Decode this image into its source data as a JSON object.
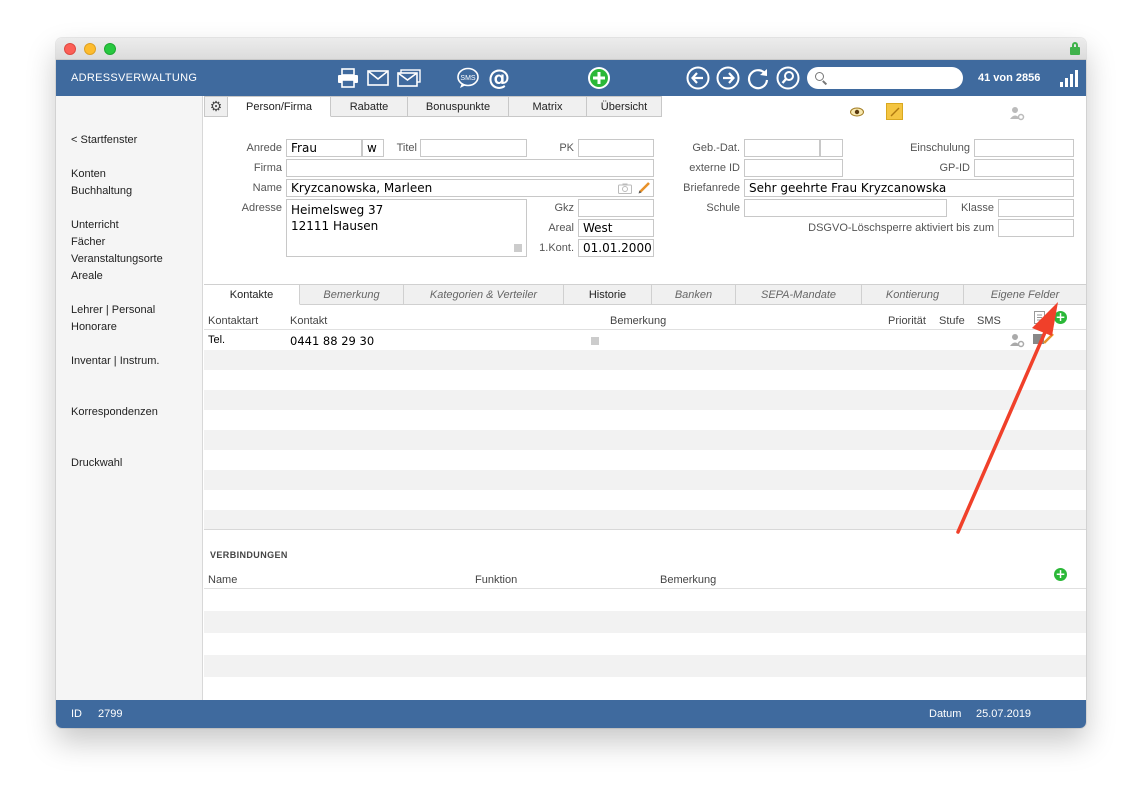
{
  "app": {
    "title": "ADRESSVERWALTUNG",
    "record_count": "41 von 2856",
    "search_placeholder": ""
  },
  "toolbar_icons": [
    "printer-icon",
    "envelope-icon",
    "envelopes-icon",
    "sms-icon",
    "at-icon",
    "add-record-icon",
    "back-arrow-icon",
    "forward-arrow-icon",
    "refresh-icon",
    "search-magnifier-icon"
  ],
  "sidebar": {
    "items": [
      "< Startfenster",
      "Konten",
      "Buchhaltung",
      "Unterricht",
      "Fächer",
      "Veranstaltungsorte",
      "Areale",
      "Lehrer | Personal",
      "Honorare",
      "Inventar | Instrum.",
      "Korrespondenzen",
      "Druckwahl"
    ]
  },
  "top_tabs": [
    "Person/Firma",
    "Rabatte",
    "Bonuspunkte",
    "Matrix",
    "Übersicht"
  ],
  "form": {
    "labels": {
      "anrede": "Anrede",
      "titel": "Titel",
      "pk": "PK",
      "firma": "Firma",
      "name": "Name",
      "adresse": "Adresse",
      "gkz": "Gkz",
      "areal": "Areal",
      "erstkontakt": "1.Kont.",
      "geb_dat": "Geb.-Dat.",
      "einschulung": "Einschulung",
      "externe_id": "externe ID",
      "gp_id": "GP-ID",
      "briefanrede": "Briefanrede",
      "schule": "Schule",
      "klasse": "Klasse",
      "dsgvo": "DSGVO-Löschsperre aktiviert bis zum"
    },
    "values": {
      "anrede": "Frau",
      "geschlecht": "w",
      "titel": "",
      "pk": "",
      "firma": "",
      "name": "Kryzcanowska, Marleen",
      "adresse": "Heimelsweg 37\n12111 Hausen",
      "gkz": "",
      "areal": "West",
      "erstkontakt": "01.01.2000",
      "geb_dat": "",
      "einschulung": "",
      "externe_id": "",
      "gp_id": "",
      "briefanrede": "Sehr geehrte Frau Kryzcanowska",
      "schule": "",
      "klasse": "",
      "dsgvo": ""
    }
  },
  "sub_tabs": [
    "Kontakte",
    "Bemerkung",
    "Kategorien & Verteiler",
    "Historie",
    "Banken",
    "SEPA-Mandate",
    "Kontierung",
    "Eigene Felder"
  ],
  "contacts": {
    "columns": {
      "kontaktart": "Kontaktart",
      "kontakt": "Kontakt",
      "bemerkung": "Bemerkung",
      "prioritaet": "Priorität",
      "stufe": "Stufe",
      "sms": "SMS"
    },
    "rows": [
      {
        "kontaktart": "Tel.",
        "kontakt": "0441 88 29 30"
      }
    ]
  },
  "connections": {
    "title": "VERBINDUNGEN",
    "columns": {
      "name": "Name",
      "funktion": "Funktion",
      "bemerkung": "Bemerkung"
    }
  },
  "status": {
    "id_label": "ID",
    "id_value": "2799",
    "datum_label": "Datum",
    "datum_value": "25.07.2019"
  },
  "colors": {
    "accent": "#3f6a9e",
    "add_green": "#2bb838",
    "annotation_arrow": "#f0402a"
  }
}
